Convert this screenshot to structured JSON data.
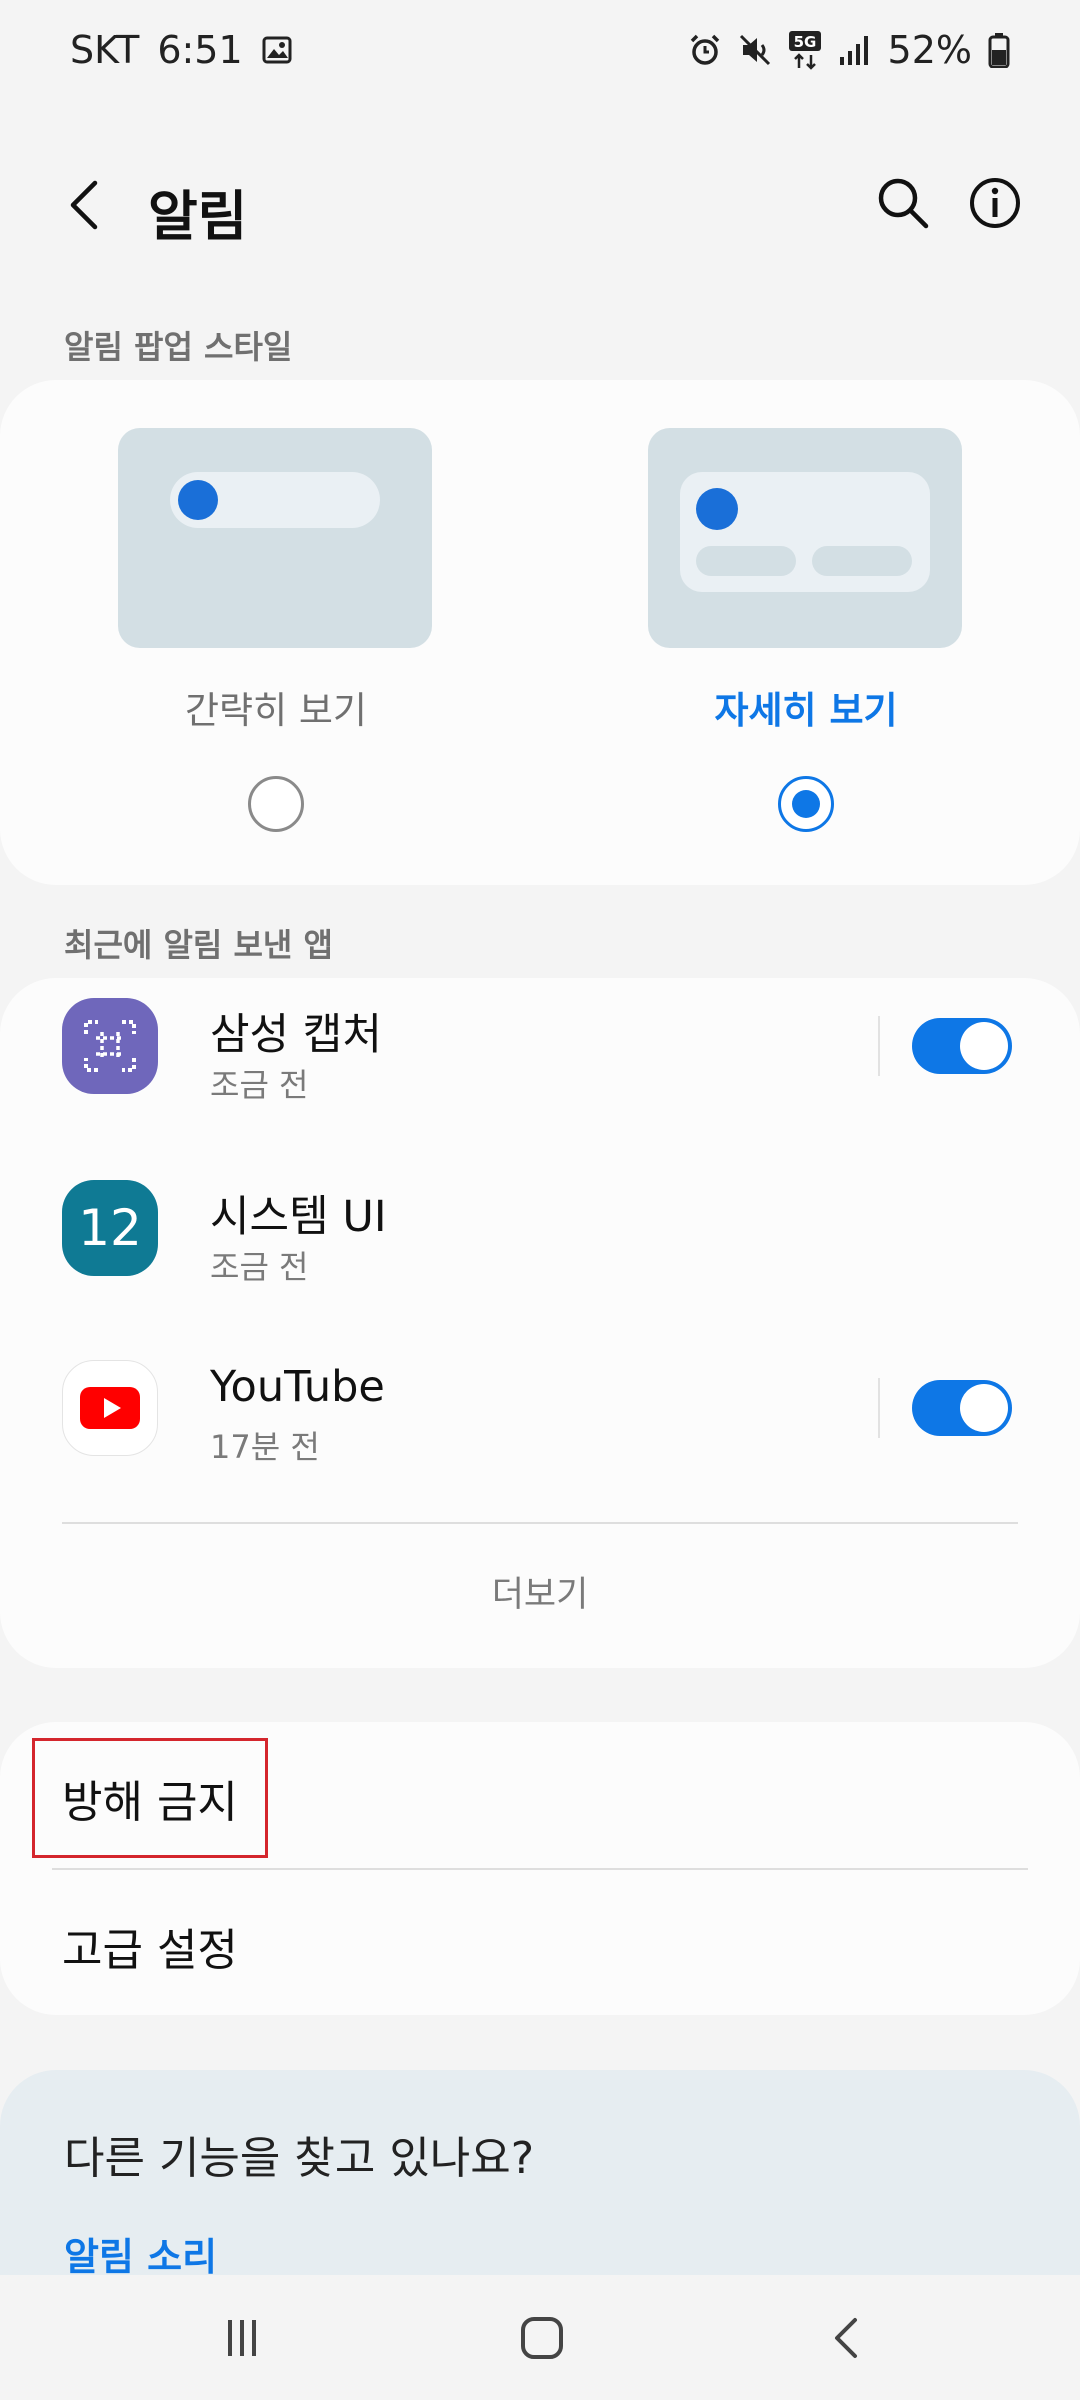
{
  "status_bar": {
    "carrier": "SKT",
    "time": "6:51",
    "battery": "52%",
    "network": "5G"
  },
  "app_bar": {
    "title": "알림"
  },
  "popup_style": {
    "header": "알림 팝업 스타일",
    "options": [
      {
        "label": "간략히 보기",
        "selected": false
      },
      {
        "label": "자세히 보기",
        "selected": true
      }
    ]
  },
  "recent_apps": {
    "header": "최근에 알림 보낸 앱",
    "items": [
      {
        "name": "삼성 캡처",
        "time": "조금 전",
        "toggle": true,
        "icon": "samsung-capture-icon"
      },
      {
        "name": "시스템 UI",
        "time": "조금 전",
        "toggle": false,
        "icon": "system-ui-icon"
      },
      {
        "name": "YouTube",
        "time": "17분 전",
        "toggle": true,
        "icon": "youtube-icon"
      }
    ],
    "more_label": "더보기"
  },
  "settings": {
    "dnd_label": "방해 금지",
    "advanced_label": "고급 설정"
  },
  "suggestions": {
    "title": "다른 기능을 찾고 있나요?",
    "link": "알림 소리"
  },
  "colors": {
    "accent": "#0e77e6",
    "highlight": "#d4262d"
  }
}
